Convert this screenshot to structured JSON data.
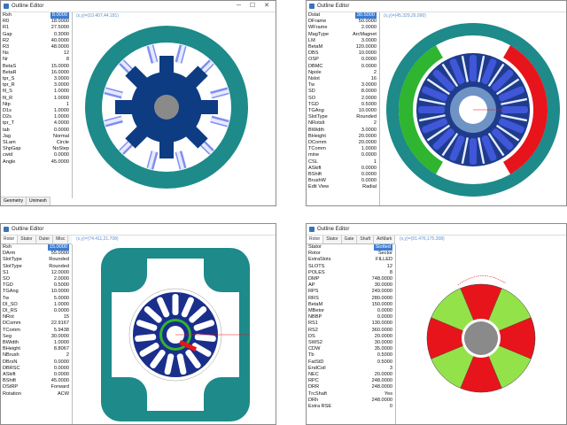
{
  "windows": [
    {
      "title": "Outline Editor",
      "coord": "(x,y)=(10.407,44.181)",
      "bottom_tabs": [
        "Geometry",
        "Unimesh"
      ],
      "params": [
        {
          "k": "Rsh",
          "v": "8.0000",
          "sel": true
        },
        {
          "k": "R0",
          "v": "18.0000"
        },
        {
          "k": "R1",
          "v": "27.5000"
        },
        {
          "k": "Gap",
          "v": "0.3000"
        },
        {
          "k": "R2",
          "v": "40.0000"
        },
        {
          "k": "R3",
          "v": "48.0000"
        },
        {
          "k": "Ns",
          "v": "12"
        },
        {
          "k": "Nr",
          "v": "8"
        },
        {
          "k": "BetaS",
          "v": "15.0000"
        },
        {
          "k": "BetaR",
          "v": "16.0000"
        },
        {
          "k": "tpr_S",
          "v": "3.0000"
        },
        {
          "k": "tpr_R",
          "v": "3.0000"
        },
        {
          "k": "fil_S",
          "v": "1.0000"
        },
        {
          "k": "fil_R",
          "v": "1.0000"
        },
        {
          "k": "Ntp",
          "v": "1"
        },
        {
          "k": "D1s",
          "v": "1.0000"
        },
        {
          "k": "D2s",
          "v": "1.0000"
        },
        {
          "k": "tpr_T",
          "v": "4.0000"
        },
        {
          "k": "tab",
          "v": "0.0000"
        },
        {
          "k": "Jag",
          "v": "Normal"
        },
        {
          "k": "SLam",
          "v": "Circle"
        },
        {
          "k": "ShpGap",
          "v": "NoStep"
        },
        {
          "k": "cwid",
          "v": "0.0000"
        },
        {
          "k": "Angle",
          "v": "45.0000"
        }
      ]
    },
    {
      "title": "Outline Editor",
      "coord": "(x,y)=(45.329,26.990)",
      "params": [
        {
          "k": "Dstat",
          "v": "30.5000",
          "sel": true
        },
        {
          "k": "DFrame",
          "v": "50.0000"
        },
        {
          "k": "WFrame",
          "v": "2.0000"
        },
        {
          "k": "MagType",
          "v": "ArcMagnet"
        },
        {
          "k": "LM",
          "v": "3.0000"
        },
        {
          "k": "BetaM",
          "v": "120.0000"
        },
        {
          "k": "DBS",
          "v": "10.0000"
        },
        {
          "k": "OSP",
          "v": "0.0000"
        },
        {
          "k": "DBMC",
          "v": "0.0000"
        },
        {
          "k": "Npole",
          "v": "2"
        },
        {
          "k": "Nslot",
          "v": "16"
        },
        {
          "k": "Tw",
          "v": "3.0000"
        },
        {
          "k": "SD",
          "v": "8.0000"
        },
        {
          "k": "SO",
          "v": "2.0000"
        },
        {
          "k": "TGD",
          "v": "0.5000"
        },
        {
          "k": "TGAng",
          "v": "10.0000"
        },
        {
          "k": "SlotType",
          "v": "Rounded"
        },
        {
          "k": "NRotslt",
          "v": "2"
        },
        {
          "k": "BWidth",
          "v": "3.0000"
        },
        {
          "k": "BHeight",
          "v": "20.0000"
        },
        {
          "k": "DComm",
          "v": "20.0000"
        },
        {
          "k": "TComm",
          "v": "1.0000"
        },
        {
          "k": "mine",
          "v": "0.0000"
        },
        {
          "k": "CSL",
          "v": "1"
        },
        {
          "k": "ASkift",
          "v": "0.0000"
        },
        {
          "k": "BShift",
          "v": "0.0000"
        },
        {
          "k": "BrushW",
          "v": "0.0000"
        },
        {
          "k": "Edit View",
          "v": "Radial"
        }
      ]
    },
    {
      "title": "Outline Editor",
      "coord": "(x,y)=(74.411,21.708)",
      "tabs": [
        "Rotor",
        "Stator",
        "Outer",
        "Misc"
      ],
      "params": [
        {
          "k": "Rsh",
          "v": "15.0000",
          "sel": true
        },
        {
          "k": "DArm",
          "v": "55.0000"
        },
        {
          "k": "SlotType",
          "v": "Rounded"
        },
        {
          "k": "SlotType",
          "v": "Rounded"
        },
        {
          "k": "S1",
          "v": "12.0000"
        },
        {
          "k": "SO",
          "v": "2.0000"
        },
        {
          "k": "TGD",
          "v": "0.5000"
        },
        {
          "k": "TGAng",
          "v": "10.0000"
        },
        {
          "k": "Tw",
          "v": "5.0000"
        },
        {
          "k": "DI_SO",
          "v": "1.0000"
        },
        {
          "k": "DI_RS",
          "v": "0.0000"
        },
        {
          "k": "NRot",
          "v": "15"
        },
        {
          "k": "DComm",
          "v": "22.9167"
        },
        {
          "k": "TComm",
          "v": "5.9438"
        },
        {
          "k": "Seg",
          "v": "30.0000"
        },
        {
          "k": "BWidth",
          "v": "1.0000"
        },
        {
          "k": "BHeight",
          "v": "8.8067"
        },
        {
          "k": "NBrush",
          "v": "2"
        },
        {
          "k": "DBrsN",
          "v": "0.0000"
        },
        {
          "k": "DBRSC",
          "v": "0.0000"
        },
        {
          "k": "ASkift",
          "v": "0.0000"
        },
        {
          "k": "BShift",
          "v": "45.0000"
        },
        {
          "k": "DStRP",
          "v": "Forward"
        },
        {
          "k": "Rotation",
          "v": "ACW"
        }
      ]
    },
    {
      "title": "Outline Editor",
      "coord": "(x,y)=(91.476,175.308)",
      "tabs": [
        "Rotor",
        "Stator",
        "Gate",
        "Shaft",
        "AirMark"
      ],
      "params": [
        {
          "k": "Stator",
          "v": "Slotted",
          "sel": true
        },
        {
          "k": "Rotor",
          "v": "Sector"
        },
        {
          "k": "ExtraSlots",
          "v": "FILLED"
        },
        {
          "k": "SLOTS",
          "v": "12"
        },
        {
          "k": "POLES",
          "v": "8"
        },
        {
          "k": "DMP",
          "v": "748.0000"
        },
        {
          "k": "AP",
          "v": "30.0000"
        },
        {
          "k": "RPS",
          "v": "249.0000"
        },
        {
          "k": "RRS",
          "v": "280.0000"
        },
        {
          "k": "BetaM",
          "v": "150.0000"
        },
        {
          "k": "MBetor",
          "v": "0.0000"
        },
        {
          "k": "NBBP",
          "v": "0.0000"
        },
        {
          "k": "RS1",
          "v": "130.0000"
        },
        {
          "k": "RS2",
          "v": "360.0000"
        },
        {
          "k": "DS",
          "v": "20.0000"
        },
        {
          "k": "SWS2",
          "v": "30.0000"
        },
        {
          "k": "CDW",
          "v": "35.0000"
        },
        {
          "k": "Tb",
          "v": "0.5000"
        },
        {
          "k": "FatStD",
          "v": "0.5000"
        },
        {
          "k": "EndCoil",
          "v": "3"
        },
        {
          "k": "NEC",
          "v": "20.0000"
        },
        {
          "k": "RPC",
          "v": "248.0000"
        },
        {
          "k": "DRR",
          "v": "248.0000"
        },
        {
          "k": "TrcShaft",
          "v": "Yes"
        },
        {
          "k": "DRh",
          "v": "248.0000"
        },
        {
          "k": "Extra RSE",
          "v": "0"
        }
      ]
    }
  ],
  "colors": {
    "teal": "#1e8a8a",
    "navy": "#0e3c82",
    "steel": "#5c8fbf",
    "slotBlue": "#5a6fe0",
    "grey": "#8a8a8a",
    "green": "#2fb52f",
    "red": "#e8141c",
    "lime": "#94e24a"
  }
}
